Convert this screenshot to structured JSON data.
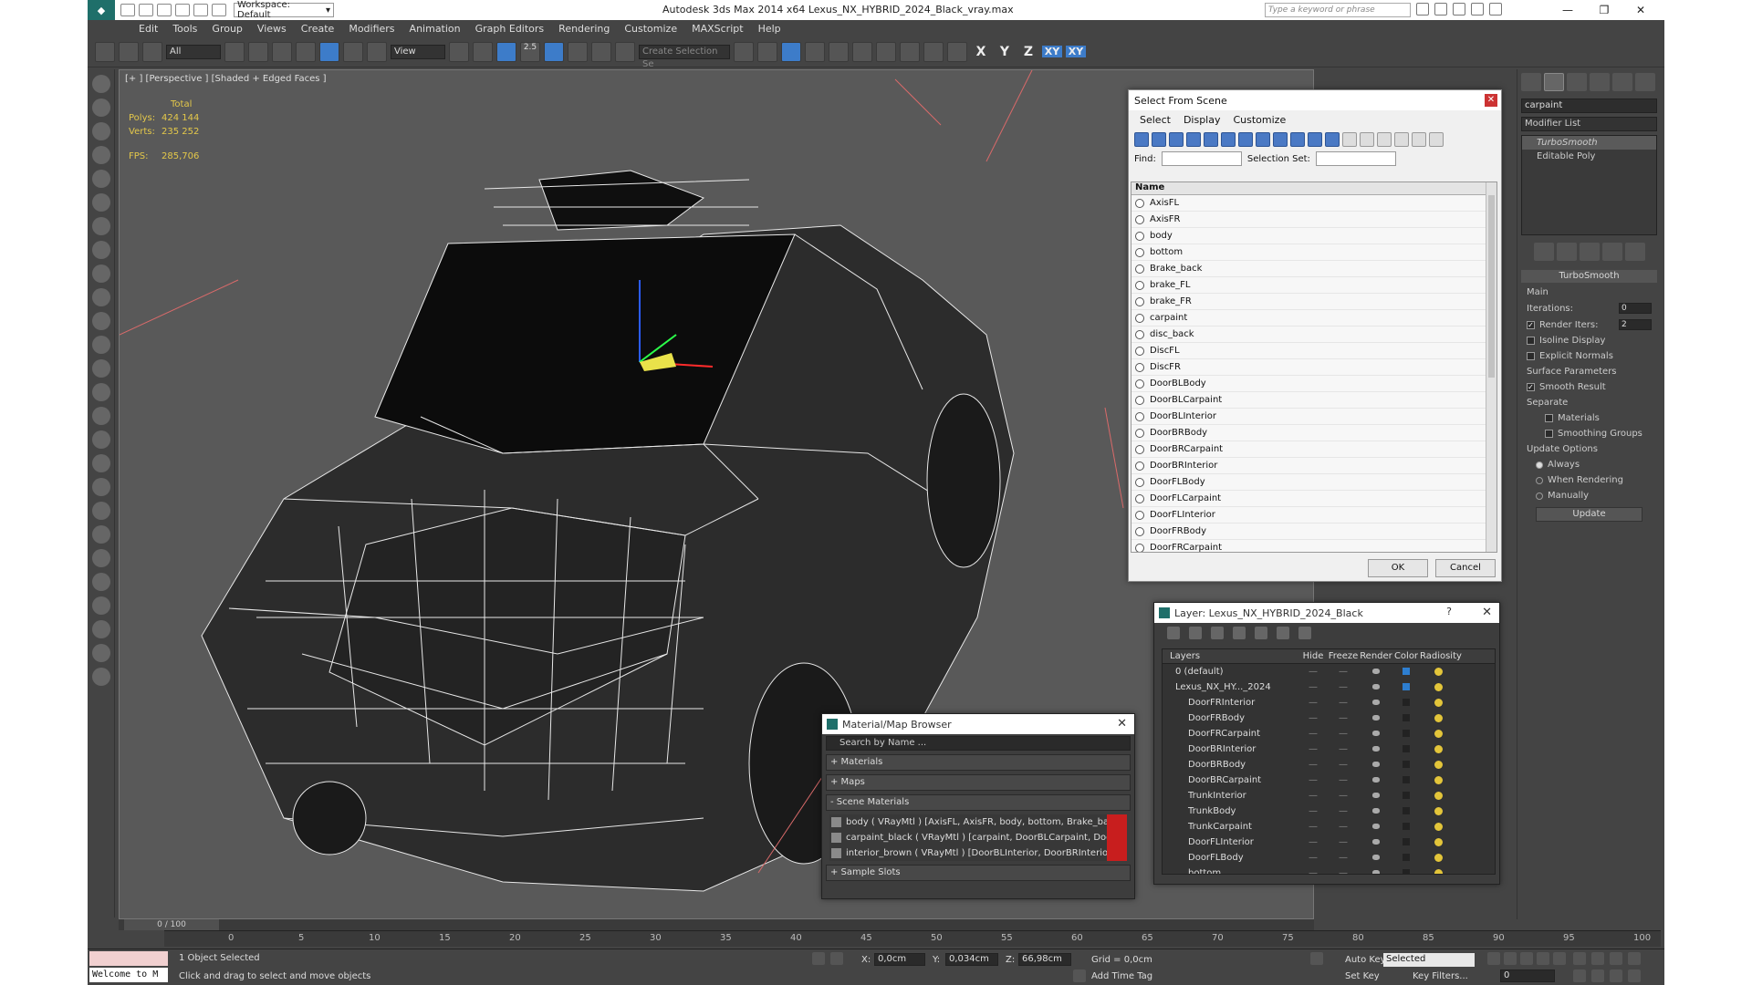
{
  "app": {
    "title": "Autodesk 3ds Max  2014 x64     Lexus_NX_HYBRID_2024_Black_vray.max",
    "workspace": "Workspace: Default",
    "search_placeholder": "Type a keyword or phrase",
    "window_controls": [
      "—",
      "❐",
      "✕"
    ]
  },
  "menu": [
    "Edit",
    "Tools",
    "Group",
    "Views",
    "Create",
    "Modifiers",
    "Animation",
    "Graph Editors",
    "Rendering",
    "Customize",
    "MAXScript",
    "Help"
  ],
  "toolbar": {
    "filter": "All",
    "coord": "View",
    "snap_value": "2.5",
    "named_selection": "Create Selection Se",
    "axes": [
      "X",
      "Y",
      "Z",
      "XY",
      "XY"
    ]
  },
  "viewport": {
    "label": "[+ ] [Perspective ] [Shaded + Edged Faces ]",
    "stats": {
      "total": "Total",
      "polys_label": "Polys:",
      "polys": "424 144",
      "verts_label": "Verts:",
      "verts": "235 252",
      "fps_label": "FPS:",
      "fps": "285,706"
    }
  },
  "select_from_scene": {
    "title": "Select From Scene",
    "menu": [
      "Select",
      "Display",
      "Customize"
    ],
    "find_label": "Find:",
    "selection_set_label": "Selection Set:",
    "column": "Name",
    "items": [
      "AxisFL",
      "AxisFR",
      "body",
      "bottom",
      "Brake_back",
      "brake_FL",
      "brake_FR",
      "carpaint",
      "disc_back",
      "DiscFL",
      "DiscFR",
      "DoorBLBody",
      "DoorBLCarpaint",
      "DoorBLInterior",
      "DoorBRBody",
      "DoorBRCarpaint",
      "DoorBRInterior",
      "DoorFLBody",
      "DoorFLCarpaint",
      "DoorFLInterior",
      "DoorFRBody",
      "DoorFRCarpaint"
    ],
    "ok": "OK",
    "cancel": "Cancel"
  },
  "command_panel": {
    "object_name": "carpaint",
    "modifier_list": "Modifier List",
    "stack": [
      "TurboSmooth",
      "Editable Poly"
    ],
    "rollout": "TurboSmooth",
    "main_label": "Main",
    "iterations_label": "Iterations:",
    "iterations": "0",
    "render_iters_label": "Render Iters:",
    "render_iters": "2",
    "isoline": "Isoline Display",
    "explicit_normals": "Explicit Normals",
    "surface_params": "Surface Parameters",
    "smooth_result": "Smooth Result",
    "separate": "Separate",
    "materials": "Materials",
    "smoothing_groups": "Smoothing Groups",
    "update_options": "Update Options",
    "always": "Always",
    "when_rendering": "When Rendering",
    "manually": "Manually",
    "update": "Update"
  },
  "material_browser": {
    "title": "Material/Map Browser",
    "search": "Search by Name ...",
    "rollouts": [
      "+ Materials",
      "+ Maps",
      "- Scene Materials",
      "+ Sample Slots"
    ],
    "scene_materials": [
      "body  ( VRayMtl ) [AxisFL, AxisFR, body, bottom, Brake_back, b...",
      "carpaint_black  ( VRayMtl ) [carpaint, DoorBLCarpaint, DoorBRC...",
      "interior_brown  ( VRayMtl ) [DoorBLInterior, DoorBRInterior, Do..."
    ]
  },
  "layer_manager": {
    "title": "Layer: Lexus_NX_HYBRID_2024_Black",
    "help": "?",
    "columns": [
      "Layers",
      "Hide",
      "Freeze",
      "Render",
      "Color",
      "Radiosity"
    ],
    "rows": [
      {
        "name": "0 (default)",
        "color": "#2d7ed0"
      },
      {
        "name": "Lexus_NX_HY..._2024",
        "color": "#2d7ed0"
      },
      {
        "name": "DoorFRInterior",
        "color": "#222222"
      },
      {
        "name": "DoorFRBody",
        "color": "#222222"
      },
      {
        "name": "DoorFRCarpaint",
        "color": "#222222"
      },
      {
        "name": "DoorBRInterior",
        "color": "#222222"
      },
      {
        "name": "DoorBRBody",
        "color": "#222222"
      },
      {
        "name": "DoorBRCarpaint",
        "color": "#222222"
      },
      {
        "name": "TrunkInterior",
        "color": "#222222"
      },
      {
        "name": "TrunkBody",
        "color": "#222222"
      },
      {
        "name": "TrunkCarpaint",
        "color": "#222222"
      },
      {
        "name": "DoorFLInterior",
        "color": "#222222"
      },
      {
        "name": "DoorFLBody",
        "color": "#222222"
      },
      {
        "name": "bottom",
        "color": "#222222"
      }
    ]
  },
  "timeline": {
    "frame": "0 / 100",
    "ticks": [
      "0",
      "5",
      "10",
      "15",
      "20",
      "25",
      "30",
      "35",
      "40",
      "45",
      "50",
      "55",
      "60",
      "65",
      "70",
      "75",
      "80",
      "85",
      "90",
      "95",
      "100"
    ]
  },
  "status": {
    "listener": "Welcome to M",
    "selected": "1 Object Selected",
    "prompt": "Click and drag to select and move objects",
    "x_label": "X:",
    "x": "0,0cm",
    "y_label": "Y:",
    "y": "0,034cm",
    "z_label": "Z:",
    "z": "66,98cm",
    "grid": "Grid = 0,0cm",
    "add_time_tag": "Add Time Tag",
    "auto_key": "Auto Key",
    "set_key": "Set Key",
    "selected_set": "Selected",
    "key_filters": "Key Filters...",
    "current_frame": "0"
  }
}
